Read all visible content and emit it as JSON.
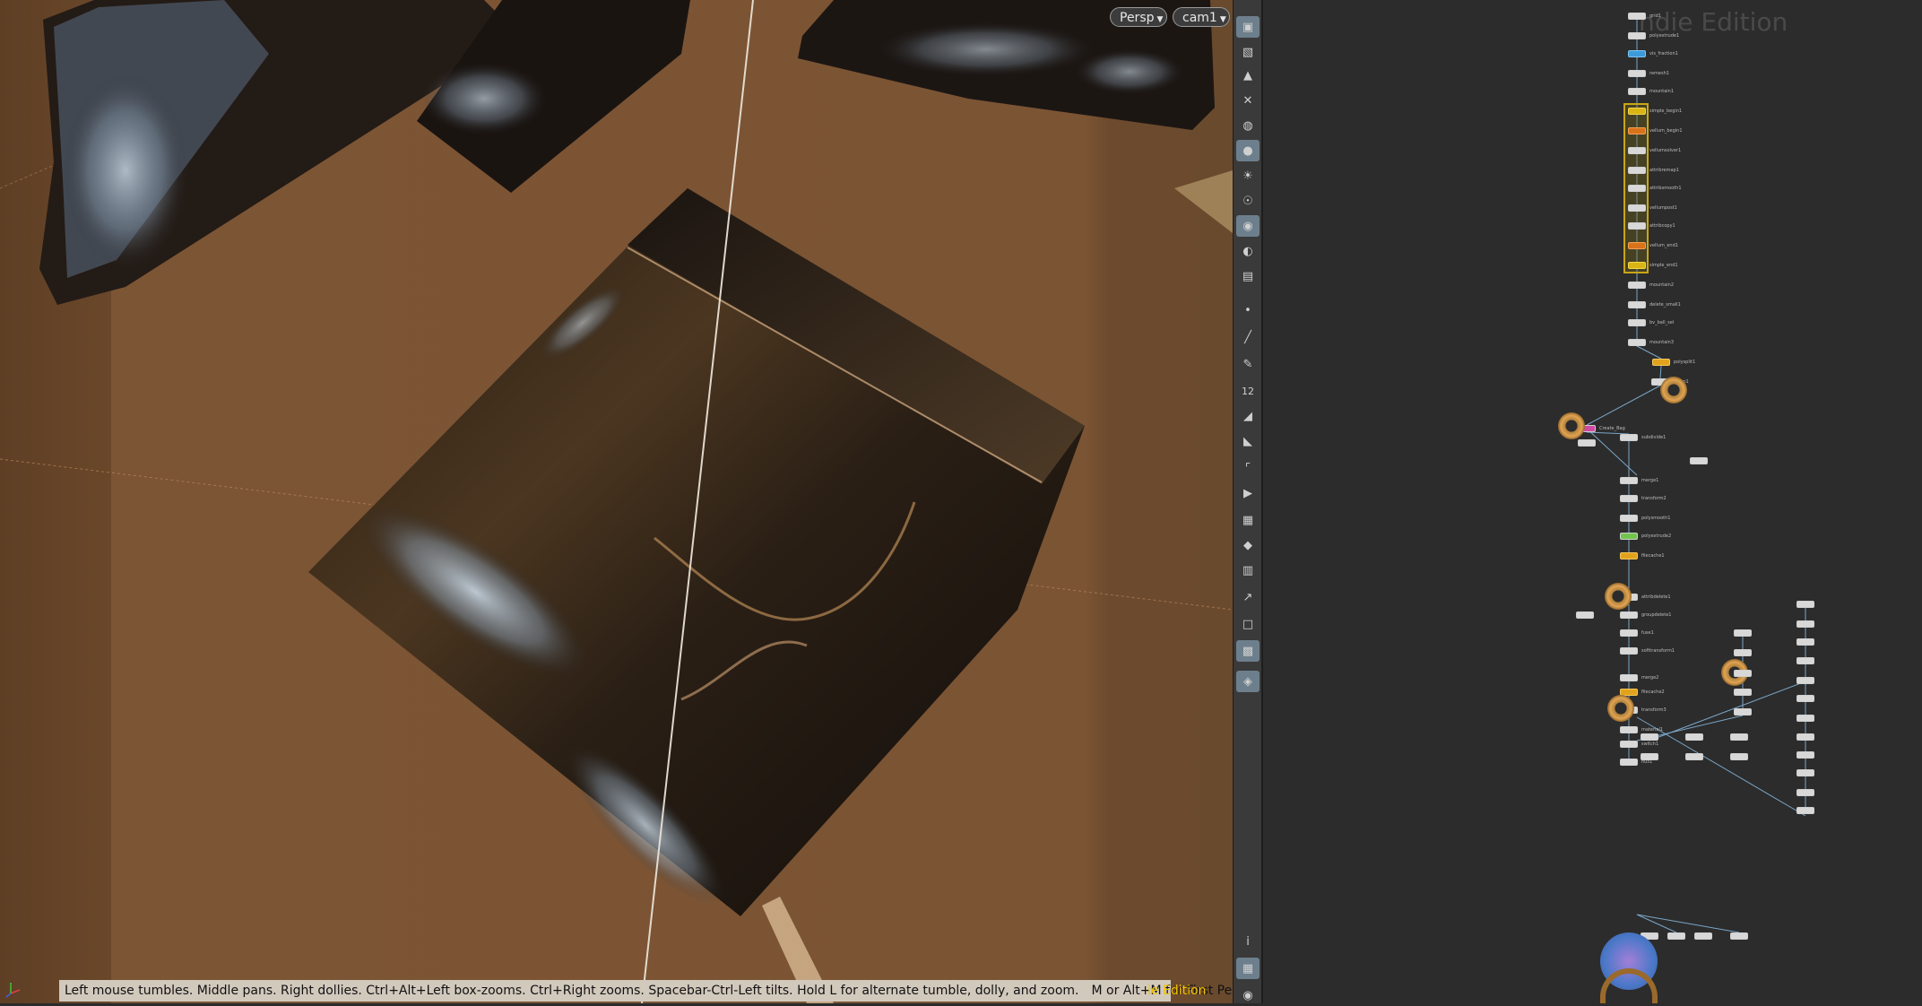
{
  "viewport": {
    "view_menu": "Persp",
    "camera_menu": "cam1",
    "status_text": "Left mouse tumbles. Middle pans. Right dollies. Ctrl+Alt+Left box-zooms. Ctrl+Right zooms. Spacebar-Ctrl-Left tilts. Hold L for alternate tumble, dolly, and zoom.",
    "status_text_2": "M or Alt+M for First Person Navigation.",
    "edition_tag": "ie Edition"
  },
  "toolbar": {
    "icons": [
      "camera-icon",
      "display-options-icon",
      "lock-icon",
      "close-icon",
      "ghost-icon",
      "light-icon",
      "bulb-icon",
      "bulb-target-icon",
      "render-icon",
      "eye-icon",
      "render-region-icon",
      "point-icon",
      "brush-icon",
      "pen-icon",
      "number-icon",
      "paint-icon",
      "paint-bucket-icon",
      "curve-icon",
      "flag-icon",
      "texture-icon",
      "diamond-icon",
      "uv-icon",
      "vector-icon",
      "box-icon",
      "snapshot-icon",
      "pin-icon",
      "info-icon",
      "grid-icon",
      "visibility-icon"
    ],
    "number_label": "12"
  },
  "network": {
    "watermark": "ndie Edition",
    "nodes": [
      {
        "label": "grid1",
        "style": "hl"
      },
      {
        "label": "polyextrude1",
        "style": "hl"
      },
      {
        "label": "vis_fraction1",
        "style": "blue"
      },
      {
        "label": "remesh1",
        "style": "hl"
      },
      {
        "label": "mountain1",
        "style": "hl"
      },
      {
        "label": "simple_begin1",
        "style": "yellow"
      },
      {
        "label": "vellum_begin1",
        "style": "orange"
      },
      {
        "label": "vellumsolver1",
        "style": "hl"
      },
      {
        "label": "attribremap1",
        "style": "hl"
      },
      {
        "label": "attribsmooth1",
        "style": "hl"
      },
      {
        "label": "vellumpost1",
        "style": "hl"
      },
      {
        "label": "attribcopy1",
        "style": "hl"
      },
      {
        "label": "vellum_end1",
        "style": "orange"
      },
      {
        "label": "simple_end1",
        "style": "yellow"
      },
      {
        "label": "mountain2",
        "style": "hl"
      },
      {
        "label": "delete_small1",
        "style": "hl"
      },
      {
        "label": "bv_ball_sel",
        "style": "hl"
      },
      {
        "label": "mountain3",
        "style": "hl"
      },
      {
        "label": "polysplit1",
        "style": "amber"
      },
      {
        "label": "group1",
        "style": "hl"
      },
      {
        "label": "Create_Bag",
        "style": "pink"
      },
      {
        "label": "subdivide1",
        "style": "hl"
      },
      {
        "label": "merge1",
        "style": "hl"
      },
      {
        "label": "transform2",
        "style": "hl"
      },
      {
        "label": "polysmooth1",
        "style": "hl"
      },
      {
        "label": "polyextrude2",
        "style": "green"
      },
      {
        "label": "filecache1",
        "style": "amber"
      },
      {
        "label": "attribdelete1",
        "style": "hl"
      },
      {
        "label": "groupdelete1",
        "style": "hl"
      },
      {
        "label": "fuse1",
        "style": "hl"
      },
      {
        "label": "softtransform1",
        "style": "hl"
      },
      {
        "label": "merge2",
        "style": "hl"
      },
      {
        "label": "filecache2",
        "style": "amber"
      },
      {
        "label": "transform3",
        "style": "hl"
      },
      {
        "label": "material1",
        "style": "hl"
      },
      {
        "label": "switch1",
        "style": "hl"
      },
      {
        "label": "null1",
        "style": "hl"
      }
    ]
  }
}
